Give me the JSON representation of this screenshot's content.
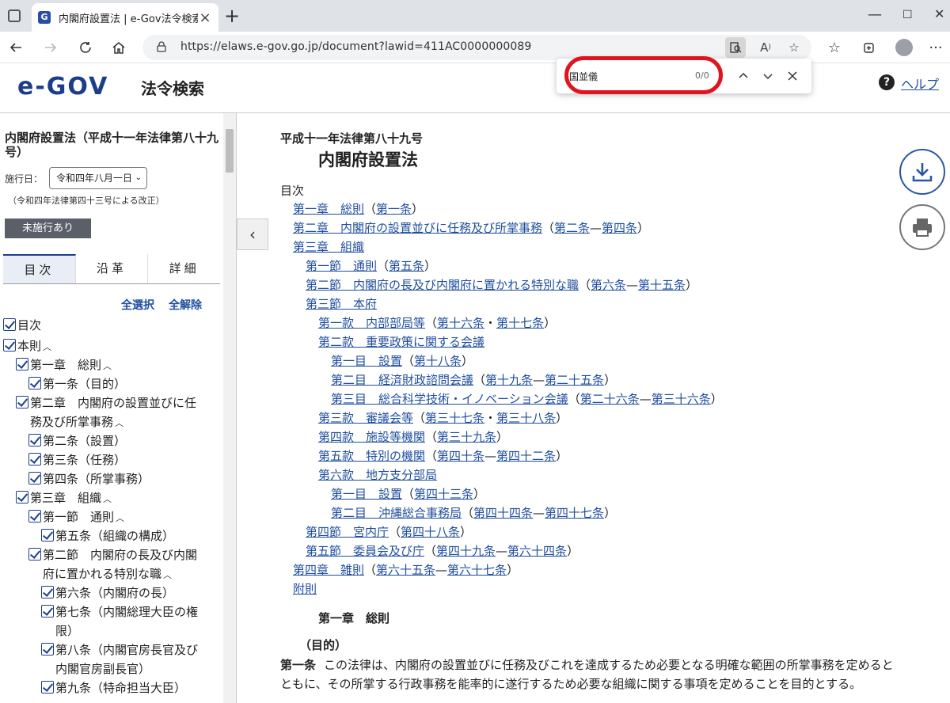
{
  "browser": {
    "tab_title": "内閣府設置法 | e-Gov法令検索",
    "url": "https://elaws.e-gov.go.jp/document?lawid=411AC0000000089"
  },
  "find": {
    "query": "国並儀",
    "count": "0/0"
  },
  "header": {
    "logo": "e-GOV",
    "service": "法令検索",
    "help": "ヘルプ"
  },
  "sidebar": {
    "title": "内閣府設置法（平成十一年法律第八十九号）",
    "date_label": "施行日：",
    "date_value": "令和四年八月一日",
    "amend": "（令和四年法律第四十三号による改正）",
    "badge": "未施行あり",
    "tabs": [
      "目次",
      "沿革",
      "詳細"
    ],
    "select_all": "全選択",
    "clear_all": "全解除",
    "toc": [
      {
        "text": "目次",
        "caret": false
      },
      {
        "text": "本則",
        "caret": true
      },
      {
        "text": "第一章　総則",
        "caret": true
      },
      {
        "text": "第一条（目的）",
        "caret": false
      },
      {
        "text": "第二章　内閣府の設置並びに任",
        "caret": false
      },
      {
        "text": "務及び所掌事務",
        "caret": true
      },
      {
        "text": "第二条（設置）",
        "caret": false
      },
      {
        "text": "第三条（任務）",
        "caret": false
      },
      {
        "text": "第四条（所掌事務）",
        "caret": false
      },
      {
        "text": "第三章　組織",
        "caret": true
      },
      {
        "text": "第一節　通則",
        "caret": true
      },
      {
        "text": "第五条（組織の構成）",
        "caret": false
      },
      {
        "text": "第二節　内閣府の長及び内閣",
        "caret": false
      },
      {
        "text": "府に置かれる特別な職",
        "caret": true
      },
      {
        "text": "第六条（内閣府の長）",
        "caret": false
      },
      {
        "text": "第七条（内閣総理大臣の権",
        "caret": false
      },
      {
        "text": "限）",
        "caret": false
      },
      {
        "text": "第八条（内閣官房長官及び",
        "caret": false
      },
      {
        "text": "内閣官房副長官）",
        "caret": false
      },
      {
        "text": "第九条（特命担当大臣）",
        "caret": false
      }
    ]
  },
  "main": {
    "law_number": "平成十一年法律第八十九号",
    "law_title": "内閣府設置法",
    "toc_heading": "目次",
    "toc": [
      {
        "link": "第一章　総則",
        "refs": [
          "第一条"
        ]
      },
      {
        "link": "第二章　内閣府の設置並びに任務及び所掌事務",
        "refs": [
          "第二条",
          "第四条"
        ],
        "sep": "—"
      },
      {
        "link": "第三章　組織",
        "refs": []
      },
      {
        "link": "第一節　通則",
        "refs": [
          "第五条"
        ]
      },
      {
        "link": "第二節　内閣府の長及び内閣府に置かれる特別な職",
        "refs": [
          "第六条",
          "第十五条"
        ],
        "sep": "—"
      },
      {
        "link": "第三節　本府",
        "refs": []
      },
      {
        "link": "第一款　内部部局等",
        "refs": [
          "第十六条",
          "第十七条"
        ],
        "sep": "・"
      },
      {
        "link": "第二款　重要政策に関する会議",
        "refs": []
      },
      {
        "link": "第一目　設置",
        "refs": [
          "第十八条"
        ]
      },
      {
        "link": "第二目　経済財政諮問会議",
        "refs": [
          "第十九条",
          "第二十五条"
        ],
        "sep": "—"
      },
      {
        "link": "第三目　総合科学技術・イノベーション会議",
        "refs": [
          "第二十六条",
          "第三十六条"
        ],
        "sep": "—"
      },
      {
        "link": "第三款　審議会等",
        "refs": [
          "第三十七条",
          "第三十八条"
        ],
        "sep": "・"
      },
      {
        "link": "第四款　施設等機関",
        "refs": [
          "第三十九条"
        ]
      },
      {
        "link": "第五款　特別の機関",
        "refs": [
          "第四十条",
          "第四十二条"
        ],
        "sep": "—"
      },
      {
        "link": "第六款　地方支分部局",
        "refs": []
      },
      {
        "link": "第一目　設置",
        "refs": [
          "第四十三条"
        ]
      },
      {
        "link": "第二目　沖縄総合事務局",
        "refs": [
          "第四十四条",
          "第四十七条"
        ],
        "sep": "—"
      },
      {
        "link": "第四節　宮内庁",
        "refs": [
          "第四十八条"
        ]
      },
      {
        "link": "第五節　委員会及び庁",
        "refs": [
          "第四十九条",
          "第六十四条"
        ],
        "sep": "—"
      },
      {
        "link": "第四章　雑則",
        "refs": [
          "第六十五条",
          "第六十七条"
        ],
        "sep": "—"
      },
      {
        "link": "附則",
        "refs": []
      }
    ],
    "chapter1": "第一章　総則",
    "article_caption": "（目的）",
    "article1_label": "第一条",
    "article1_text": "この法律は、内閣府の設置並びに任務及びこれを達成するため必要となる明確な範囲の所掌事務を定めるとともに、その所掌する行政事務を能率的に遂行するため必要な組織に関する事項を定めることを目的とする。"
  }
}
